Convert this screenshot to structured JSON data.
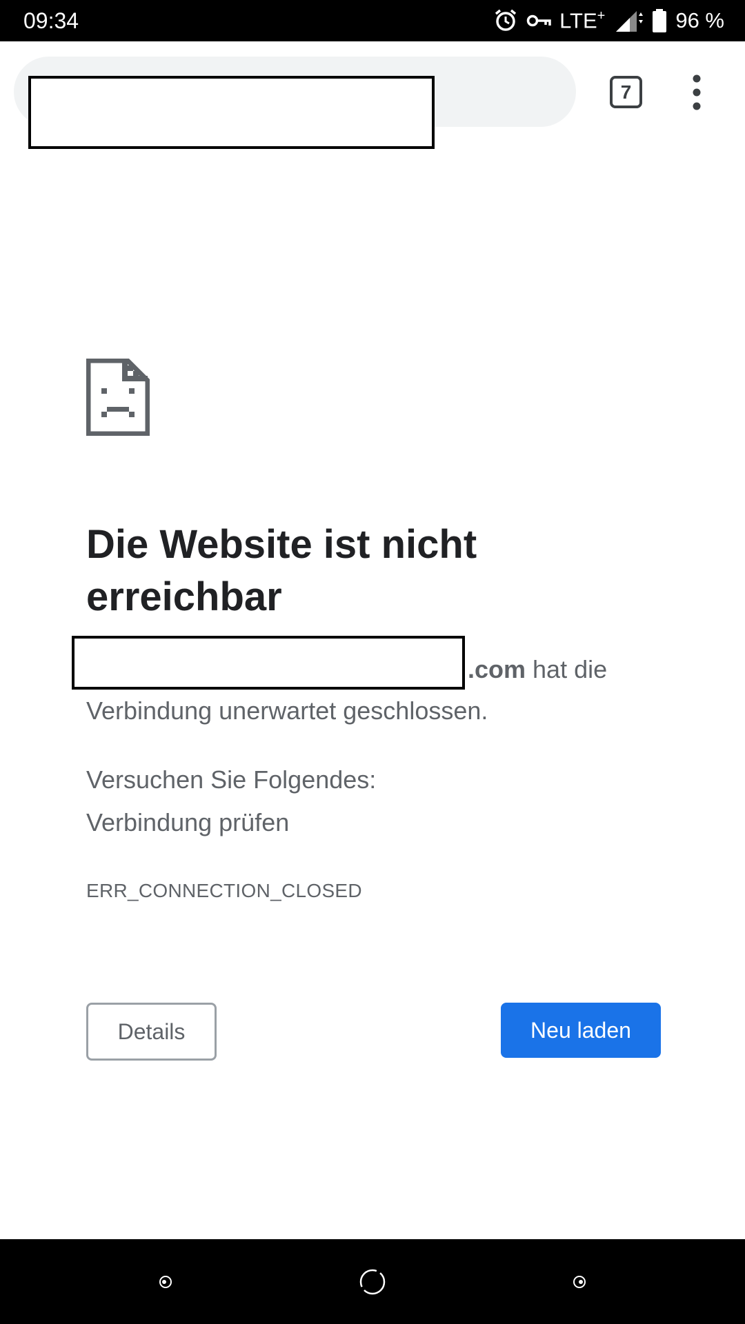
{
  "status_bar": {
    "time": "09:34",
    "network": "LTE",
    "battery": "96 %",
    "icons": [
      "alarm-icon",
      "vpn-key-icon",
      "signal-icon",
      "battery-icon"
    ]
  },
  "toolbar": {
    "tab_count": "7",
    "icons": [
      "tab-switcher-icon",
      "more-vert-icon"
    ]
  },
  "error_page": {
    "icon": "sad-document-icon",
    "title": "Die Website ist nicht erreichbar",
    "domain_suffix": ".com",
    "description_part1": " hat die",
    "description_part2": "Verbindung unerwartet geschlossen.",
    "suggestions_heading": "Versuchen Sie Folgendes:",
    "suggestion_1": "Verbindung prüfen",
    "error_code": "ERR_CONNECTION_CLOSED",
    "details_label": "Details",
    "reload_label": "Neu laden"
  },
  "colors": {
    "accent": "#1a73e8",
    "text_primary": "#202124",
    "text_secondary": "#5f6368"
  },
  "nav_bar": {
    "icons": [
      "back-icon",
      "home-icon",
      "recents-icon"
    ]
  }
}
